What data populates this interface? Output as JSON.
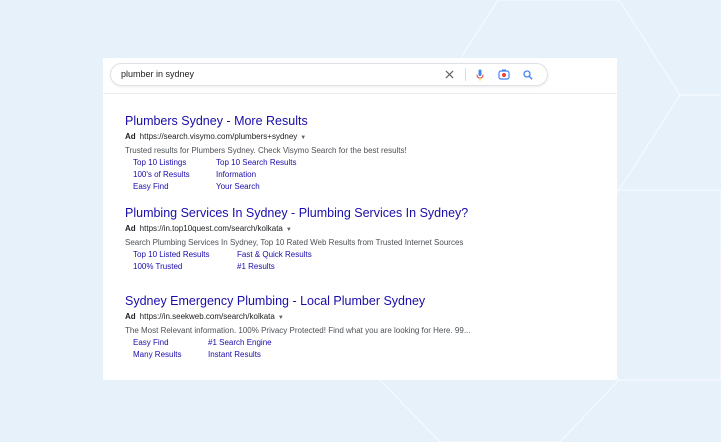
{
  "search": {
    "query": "plumber in sydney"
  },
  "icons": {
    "clear": "close-icon",
    "voice": "microphone-icon",
    "lens": "camera-lens-icon",
    "search": "search-icon"
  },
  "colors": {
    "background": "#e6f1fa",
    "link": "#1a0dab",
    "google_blue": "#4285f4"
  },
  "ad_label": "Ad",
  "results": [
    {
      "title": "Plumbers Sydney - More Results",
      "url": "https://search.visymo.com/plumbers+sydney",
      "description": "Trusted results for Plumbers Sydney. Check Visymo Search for the best results!",
      "sitelinks": [
        "Top 10 Listings",
        "Top 10 Search Results",
        "100's of Results",
        "Information",
        "Easy Find",
        "Your Search"
      ]
    },
    {
      "title": "Plumbing Services In Sydney - Plumbing Services In Sydney?",
      "url": "https://in.top10quest.com/search/kolkata",
      "description": "Search Plumbing Services In Sydney, Top 10 Rated Web Results from Trusted Internet Sources",
      "sitelinks": [
        "Top 10 Listed Results",
        "Fast & Quick Results",
        "100% Trusted",
        "#1 Results"
      ]
    },
    {
      "title": "Sydney Emergency Plumbing - Local Plumber Sydney",
      "url": "https://in.seekweb.com/search/kolkata",
      "description": "The Most Relevant information. 100% Privacy Protected! Find what you are looking for Here. 99...",
      "sitelinks": [
        "Easy Find",
        "#1 Search Engine",
        "Many Results",
        "Instant Results"
      ]
    }
  ]
}
